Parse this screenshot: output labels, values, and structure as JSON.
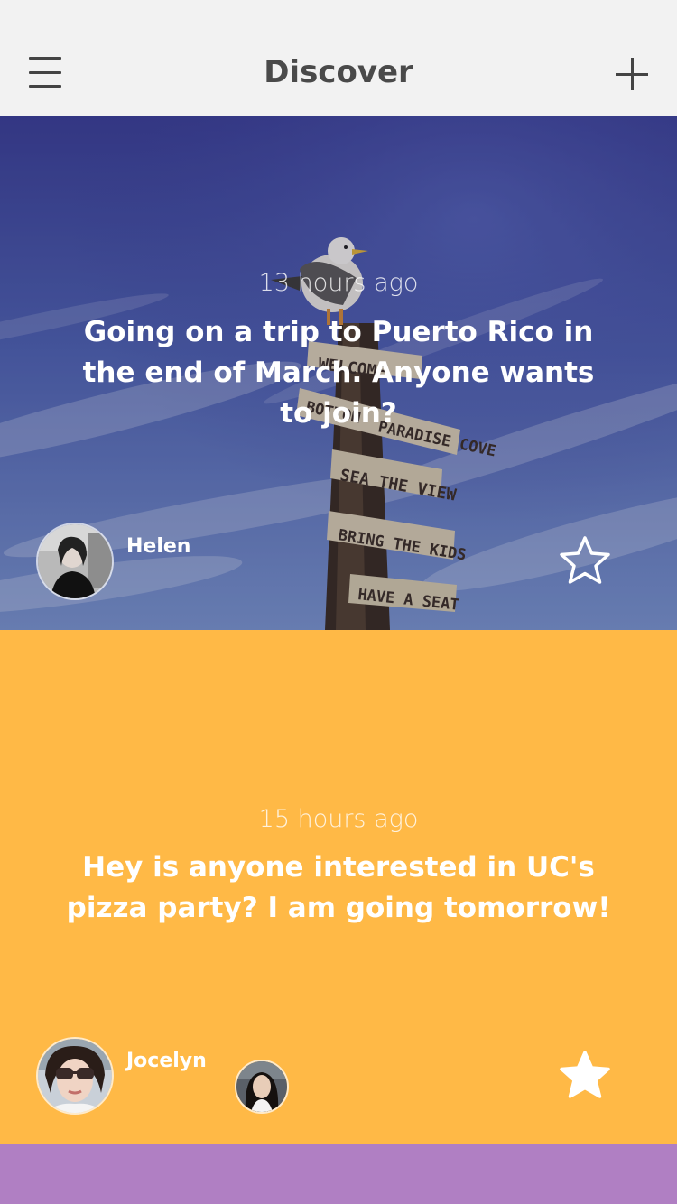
{
  "header": {
    "title": "Discover",
    "menu_icon": "hamburger-menu-icon",
    "add_icon": "plus-icon"
  },
  "posts": [
    {
      "time": "13 hours ago",
      "text": "Going on a trip to Puerto Rico in the end of March. Anyone wants to join?",
      "author": "Helen",
      "starred": false,
      "background": "photo-seagull-signpost-sky",
      "sign_texts": [
        "WELCOME",
        "BOTTOM",
        "PARADISE COVE",
        "SEA THE VIEW",
        "BRING THE KIDS",
        "HAVE A SEAT"
      ]
    },
    {
      "time": "15 hours ago",
      "text": "Hey is anyone interested in UC's pizza party? I am going tomorrow!",
      "author": "Jocelyn",
      "starred": true,
      "background_color": "#ffb946"
    }
  ],
  "colors": {
    "header_bg": "#f2f2f2",
    "card2_bg": "#ffb946",
    "card3_bg": "#b07fc3"
  }
}
